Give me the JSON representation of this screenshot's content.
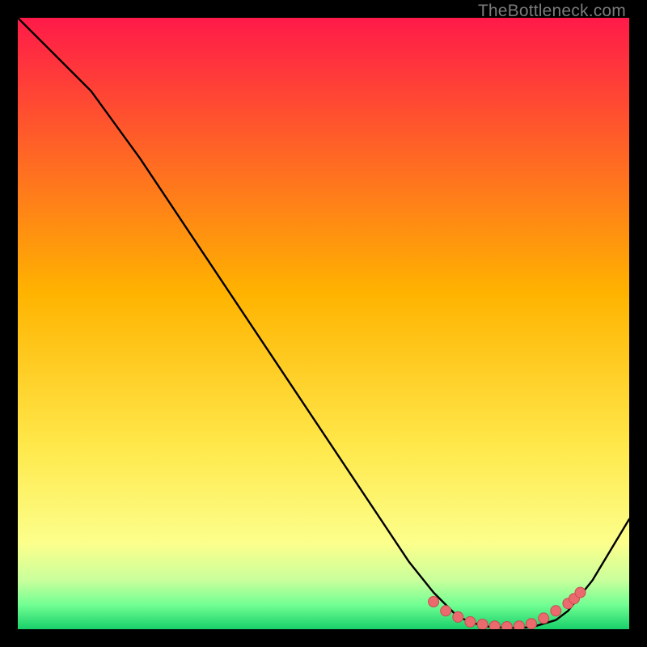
{
  "attribution": "TheBottleneck.com",
  "colors": {
    "gradient_top": "#ff1a49",
    "gradient_mid": "#ffd200",
    "gradient_yellow": "#fff76a",
    "gradient_green_top": "#d4ff9d",
    "gradient_green_mid": "#7bff8f",
    "gradient_green_bottom": "#18d06a",
    "line": "#000000",
    "dot_fill": "#ea6a6d",
    "dot_stroke": "#c84d52",
    "background": "#000000"
  },
  "chart_data": {
    "type": "line",
    "xlabel": "",
    "ylabel": "",
    "xlim": [
      0,
      100
    ],
    "ylim": [
      0,
      100
    ],
    "title": "",
    "series": [
      {
        "name": "bottleneck-curve",
        "x": [
          0,
          6,
          12,
          20,
          30,
          40,
          50,
          58,
          64,
          68,
          72,
          76,
          80,
          84,
          88,
          90,
          94,
          100
        ],
        "y": [
          100,
          94,
          88,
          77,
          62,
          47,
          32,
          20,
          11,
          6,
          2,
          0.5,
          0.2,
          0.3,
          1.5,
          3,
          8,
          18
        ]
      }
    ],
    "highlight_dots": {
      "name": "flat-region-dots",
      "x": [
        68,
        70,
        72,
        74,
        76,
        78,
        80,
        82,
        84,
        86,
        88,
        90,
        91,
        92
      ],
      "y": [
        4.5,
        3.0,
        2.0,
        1.2,
        0.8,
        0.5,
        0.4,
        0.5,
        0.9,
        1.8,
        3.0,
        4.2,
        5.0,
        6.0
      ]
    }
  }
}
